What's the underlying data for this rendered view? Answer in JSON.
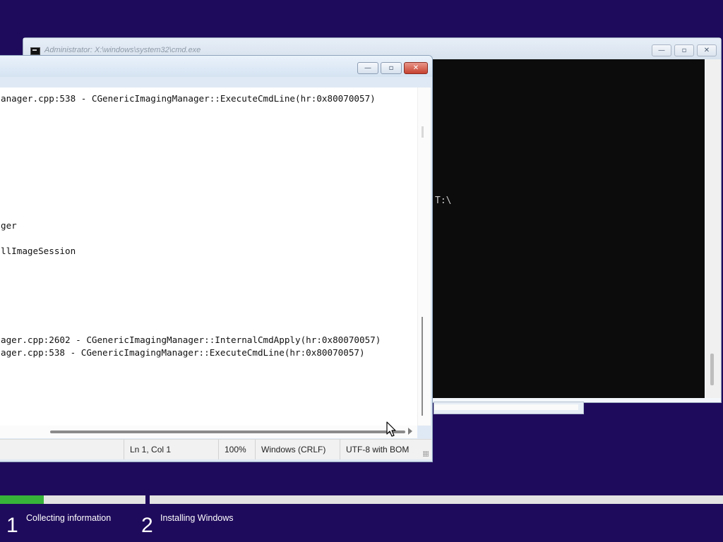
{
  "cmd": {
    "title": "Administrator: X:\\windows\\system32\\cmd.exe",
    "console_text": "T:\\",
    "buttons": {
      "minimize": "—",
      "maximize": "▫",
      "close": "✕"
    }
  },
  "notepad": {
    "buttons": {
      "minimize": "—",
      "maximize": "▫",
      "close": "✕"
    },
    "lines": [
      "anager.cpp:538 - CGenericImagingManager::ExecuteCmdLine(hr:0x80070057)",
      "ger",
      "llImageSession",
      "ager.cpp:2602 - CGenericImagingManager::InternalCmdApply(hr:0x80070057)",
      "ager.cpp:538 - CGenericImagingManager::ExecuteCmdLine(hr:0x80070057)"
    ],
    "status": {
      "position": "Ln 1, Col 1",
      "zoom": "100%",
      "line_ending": "Windows (CRLF)",
      "encoding": "UTF-8 with BOM"
    }
  },
  "setup": {
    "steps": [
      {
        "number": "1",
        "label": "Collecting information"
      },
      {
        "number": "2",
        "label": "Installing Windows"
      }
    ],
    "step1_progress": 0.3,
    "colors": {
      "background": "#1f0b5c",
      "progress": "#38b33a"
    }
  }
}
